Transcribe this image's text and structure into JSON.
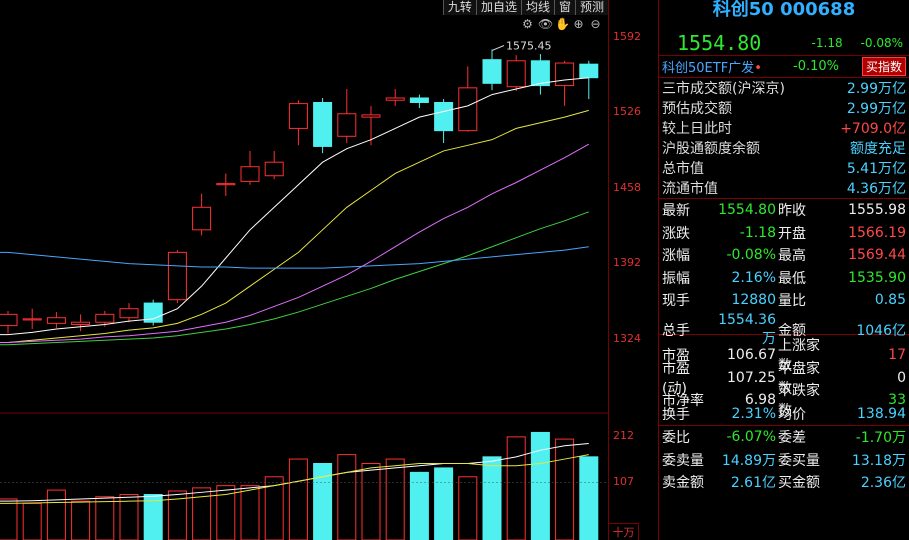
{
  "toolbar": {
    "items": [
      "九转",
      "加自选",
      "均线",
      "窗",
      "预测"
    ]
  },
  "tool_icons": [
    "settings-icon",
    "eye-icon",
    "hand-icon",
    "zoom-in-icon",
    "zoom-out-icon"
  ],
  "header": {
    "title": "科创50 000688",
    "price": "1554.80",
    "change": "-1.18",
    "change_pct": "-0.08%"
  },
  "etf": {
    "name": "科创50ETF广发",
    "dot": "•",
    "pct": "-0.10%",
    "button": "买指数"
  },
  "summary": [
    {
      "k": "三市成交额(沪深京)",
      "v": "2.99万亿",
      "color": "cyan"
    },
    {
      "k": "预估成交额",
      "v": "2.99万亿",
      "color": "cyan"
    },
    {
      "k": "较上日此时",
      "v": "+709.0亿",
      "color": "red"
    },
    {
      "k": "沪股通额度余额",
      "v": "额度充足",
      "color": "cyan"
    },
    {
      "k": "总市值",
      "v": "5.41万亿",
      "color": "cyan"
    },
    {
      "k": "流通市值",
      "v": "4.36万亿",
      "color": "cyan"
    }
  ],
  "quote1": [
    {
      "k1": "最新",
      "v1": "1554.80",
      "c1": "green",
      "k2": "昨收",
      "v2": "1555.98",
      "c2": "white"
    },
    {
      "k1": "涨跌",
      "v1": "-1.18",
      "c1": "green",
      "k2": "开盘",
      "v2": "1566.19",
      "c2": "red"
    },
    {
      "k1": "涨幅",
      "v1": "-0.08%",
      "c1": "green",
      "k2": "最高",
      "v2": "1569.44",
      "c2": "red"
    },
    {
      "k1": "振幅",
      "v1": "2.16%",
      "c1": "cyan",
      "k2": "最低",
      "v2": "1535.90",
      "c2": "green"
    },
    {
      "k1": "现手",
      "v1": "12880",
      "c1": "cyan",
      "k2": "量比",
      "v2": "0.85",
      "c2": "cyan"
    },
    {
      "k1": "总手",
      "v1": "1554.36万",
      "c1": "cyan",
      "k2": "金额",
      "v2": "1046亿",
      "c2": "cyan"
    }
  ],
  "quote2": [
    {
      "k1": "市盈",
      "v1": "106.67",
      "c1": "white",
      "k2": "上涨家数",
      "v2": "17",
      "c2": "red"
    },
    {
      "k1": "市盈(动)",
      "v1": "107.25",
      "c1": "white",
      "k2": "平盘家数",
      "v2": "0",
      "c2": "white"
    },
    {
      "k1": "市净率",
      "v1": "6.98",
      "c1": "white",
      "k2": "下跌家数",
      "v2": "33",
      "c2": "green"
    },
    {
      "k1": "换手",
      "v1": "2.31%",
      "c1": "cyan",
      "k2": "均价",
      "v2": "138.94",
      "c2": "cyan"
    }
  ],
  "quote3": [
    {
      "k1": "委比",
      "v1": "-6.07%",
      "c1": "green",
      "k2": "委差",
      "v2": "-1.70万",
      "c2": "green"
    },
    {
      "k1": "委卖量",
      "v1": "14.89万",
      "c1": "cyan",
      "k2": "委买量",
      "v2": "13.18万",
      "c2": "cyan"
    },
    {
      "k1": "卖金额",
      "v1": "2.61亿",
      "c1": "cyan",
      "k2": "买金额",
      "v2": "2.36亿",
      "c2": "cyan"
    }
  ],
  "chart_data": {
    "type": "candlestick",
    "price_axis": {
      "ticks": [
        1592,
        1526,
        1458,
        1392,
        1324
      ],
      "ylim": [
        1296,
        1618
      ]
    },
    "volume_axis": {
      "ticks": [
        212,
        107
      ],
      "unit": "十万",
      "ylim": [
        0,
        232
      ]
    },
    "max_label": "1575.45",
    "candles": [
      {
        "o": 1335,
        "c": 1345,
        "h": 1348,
        "l": 1328,
        "v": 70
      },
      {
        "o": 1340,
        "c": 1341,
        "h": 1350,
        "l": 1332,
        "v": 60
      },
      {
        "o": 1337,
        "c": 1342,
        "h": 1347,
        "l": 1333,
        "v": 90
      },
      {
        "o": 1336,
        "c": 1338,
        "h": 1345,
        "l": 1330,
        "v": 65
      },
      {
        "o": 1338,
        "c": 1345,
        "h": 1348,
        "l": 1334,
        "v": 75
      },
      {
        "o": 1342,
        "c": 1350,
        "h": 1355,
        "l": 1338,
        "v": 80
      },
      {
        "o": 1355,
        "c": 1338,
        "h": 1358,
        "l": 1335,
        "v": 80
      },
      {
        "o": 1358,
        "c": 1400,
        "h": 1402,
        "l": 1355,
        "v": 88
      },
      {
        "o": 1420,
        "c": 1440,
        "h": 1452,
        "l": 1415,
        "v": 95
      },
      {
        "o": 1460,
        "c": 1461,
        "h": 1470,
        "l": 1450,
        "v": 100
      },
      {
        "o": 1463,
        "c": 1476,
        "h": 1490,
        "l": 1460,
        "v": 100
      },
      {
        "o": 1468,
        "c": 1480,
        "h": 1490,
        "l": 1465,
        "v": 120
      },
      {
        "o": 1510,
        "c": 1532,
        "h": 1535,
        "l": 1495,
        "v": 160
      },
      {
        "o": 1533,
        "c": 1494,
        "h": 1537,
        "l": 1488,
        "v": 150
      },
      {
        "o": 1503,
        "c": 1523,
        "h": 1545,
        "l": 1497,
        "v": 170
      },
      {
        "o": 1520,
        "c": 1522,
        "h": 1530,
        "l": 1495,
        "v": 150
      },
      {
        "o": 1535,
        "c": 1537,
        "h": 1545,
        "l": 1530,
        "v": 160
      },
      {
        "o": 1537,
        "c": 1533,
        "h": 1540,
        "l": 1528,
        "v": 130
      },
      {
        "o": 1533,
        "c": 1508,
        "h": 1536,
        "l": 1497,
        "v": 140
      },
      {
        "o": 1508,
        "c": 1546,
        "h": 1565,
        "l": 1507,
        "v": 120
      },
      {
        "o": 1571,
        "c": 1550,
        "h": 1580,
        "l": 1544,
        "v": 165
      },
      {
        "o": 1547,
        "c": 1570,
        "h": 1575,
        "l": 1543,
        "v": 210
      },
      {
        "o": 1570,
        "c": 1548,
        "h": 1576,
        "l": 1540,
        "v": 220
      },
      {
        "o": 1548,
        "c": 1568,
        "h": 1570,
        "l": 1530,
        "v": 205
      },
      {
        "o": 1567,
        "c": 1555,
        "h": 1570,
        "l": 1536,
        "v": 165
      }
    ],
    "ma_lines": [
      {
        "color": "#ffffff",
        "values": [
          1327,
          1329,
          1332,
          1334,
          1336,
          1339,
          1341,
          1350,
          1370,
          1395,
          1420,
          1440,
          1460,
          1480,
          1492,
          1500,
          1510,
          1520,
          1525,
          1530,
          1540,
          1545,
          1550,
          1553,
          1555
        ]
      },
      {
        "color": "#e6e640",
        "values": [
          1320,
          1322,
          1324,
          1326,
          1328,
          1331,
          1333,
          1337,
          1345,
          1355,
          1370,
          1385,
          1400,
          1420,
          1440,
          1455,
          1470,
          1480,
          1490,
          1495,
          1500,
          1510,
          1515,
          1520,
          1526
        ]
      },
      {
        "color": "#e070ff",
        "values": [
          1320,
          1321,
          1322,
          1323,
          1325,
          1326,
          1328,
          1330,
          1334,
          1338,
          1344,
          1352,
          1360,
          1370,
          1380,
          1392,
          1405,
          1418,
          1430,
          1440,
          1452,
          1462,
          1473,
          1484,
          1496
        ]
      },
      {
        "color": "#40d040",
        "values": [
          1318,
          1319,
          1320,
          1321,
          1322,
          1323,
          1324,
          1326,
          1329,
          1332,
          1336,
          1341,
          1347,
          1354,
          1361,
          1368,
          1376,
          1383,
          1390,
          1397,
          1405,
          1413,
          1421,
          1428,
          1436
        ]
      },
      {
        "color": "#4aa6ff",
        "values": [
          1400,
          1398,
          1396,
          1394,
          1392,
          1390,
          1389,
          1388,
          1387,
          1387,
          1386,
          1386,
          1386,
          1386,
          1387,
          1388,
          1389,
          1390,
          1392,
          1394,
          1396,
          1398,
          1400,
          1402,
          1405
        ]
      }
    ],
    "volume_ma_lines": [
      {
        "color": "#ffffff",
        "values": [
          65,
          66,
          68,
          70,
          72,
          74,
          76,
          80,
          85,
          90,
          95,
          100,
          110,
          120,
          130,
          135,
          140,
          145,
          150,
          150,
          155,
          165,
          180,
          190,
          195
        ]
      },
      {
        "color": "#e6e640",
        "values": [
          60,
          61,
          62,
          63,
          64,
          65,
          66,
          70,
          75,
          80,
          90,
          100,
          110,
          120,
          130,
          140,
          145,
          150,
          150,
          150,
          145,
          145,
          150,
          160,
          170
        ]
      }
    ]
  }
}
